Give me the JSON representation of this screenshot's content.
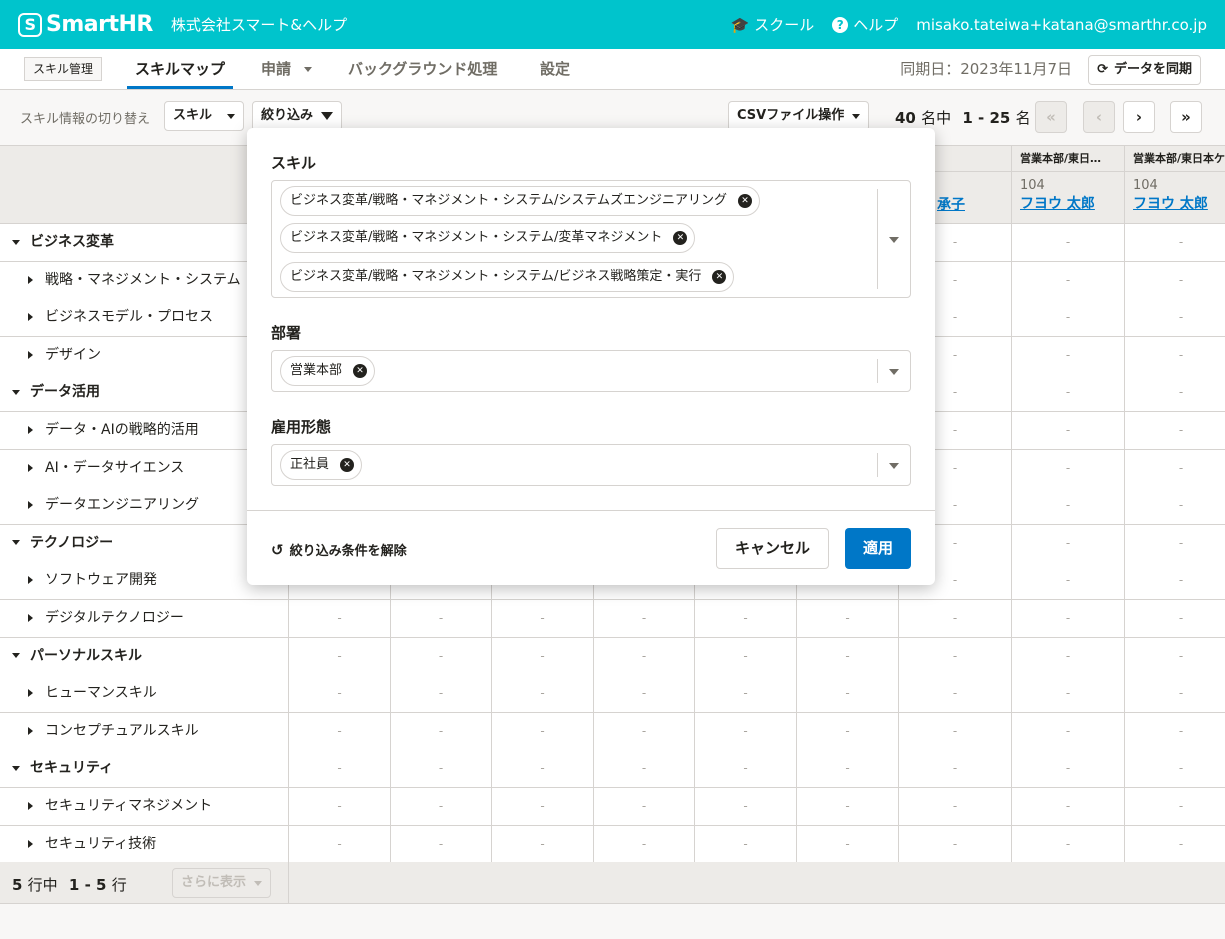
{
  "header": {
    "logo": "SmartHR",
    "tenant": "株式会社スマート&ヘルプ",
    "school": "スクール",
    "help": "ヘルプ",
    "user": "misako.tateiwa+katana@smarthr.co.jp"
  },
  "tabs": {
    "app_label": "スキル管理",
    "items": [
      "スキルマップ",
      "申請",
      "バックグラウンド処理",
      "設定"
    ],
    "sync_date": "同期日：2023年11月7日",
    "sync_button": "データを同期"
  },
  "toolbar": {
    "switch_label": "スキル情報の切り替え",
    "switch_value": "スキル",
    "filter": "絞り込み",
    "csv": "CSVファイル操作",
    "count_total": "40",
    "count_total_unit": "名中",
    "count_range": "1 - 25",
    "count_range_unit": "名",
    "first": "«",
    "prev": "‹",
    "next": "›",
    "last": "»"
  },
  "columns": [
    {
      "dept": "本部",
      "num": "",
      "name": "承子"
    },
    {
      "dept": "営業本部/東日…",
      "num": "104",
      "name": "フヨウ 太郎"
    },
    {
      "dept": "営業本部/東日本ケ",
      "num": "104",
      "name": "フヨウ 太郎"
    }
  ],
  "rows": [
    {
      "label": "ビジネス変革",
      "type": "cat"
    },
    {
      "label": "戦略・マネジメント・システム",
      "type": "sub"
    },
    {
      "label": "ビジネスモデル・プロセス",
      "type": "sub"
    },
    {
      "label": "デザイン",
      "type": "sub"
    },
    {
      "label": "データ活用",
      "type": "cat"
    },
    {
      "label": "データ・AIの戦略的活用",
      "type": "sub"
    },
    {
      "label": "AI・データサイエンス",
      "type": "sub"
    },
    {
      "label": "データエンジニアリング",
      "type": "sub"
    },
    {
      "label": "テクノロジー",
      "type": "cat"
    },
    {
      "label": "ソフトウェア開発",
      "type": "sub"
    },
    {
      "label": "デジタルテクノロジー",
      "type": "sub"
    },
    {
      "label": "パーソナルスキル",
      "type": "cat"
    },
    {
      "label": "ヒューマンスキル",
      "type": "sub"
    },
    {
      "label": "コンセプチュアルスキル",
      "type": "sub"
    },
    {
      "label": "セキュリティ",
      "type": "cat"
    },
    {
      "label": "セキュリティマネジメント",
      "type": "sub"
    },
    {
      "label": "セキュリティ技術",
      "type": "sub"
    }
  ],
  "cell_placeholder": "-",
  "footer": {
    "count_total": "5",
    "count_total_unit": "行中",
    "count_range": "1 - 5",
    "count_range_unit": "行",
    "more": "さらに表示"
  },
  "filter_popover": {
    "skill_label": "スキル",
    "skills": [
      "ビジネス変革/戦略・マネジメント・システム/システムズエンジニアリング",
      "ビジネス変革/戦略・マネジメント・システム/変革マネジメント",
      "ビジネス変革/戦略・マネジメント・システム/ビジネス戦略策定・実行"
    ],
    "dept_label": "部署",
    "depts": [
      "営業本部"
    ],
    "employment_label": "雇用形態",
    "employment": [
      "正社員"
    ],
    "reset": "絞り込み条件を解除",
    "cancel": "キャンセル",
    "apply": "適用"
  },
  "colors": {
    "brand": "#00c4cc",
    "primary": "#0077c7",
    "border": "#d6d3d0"
  }
}
